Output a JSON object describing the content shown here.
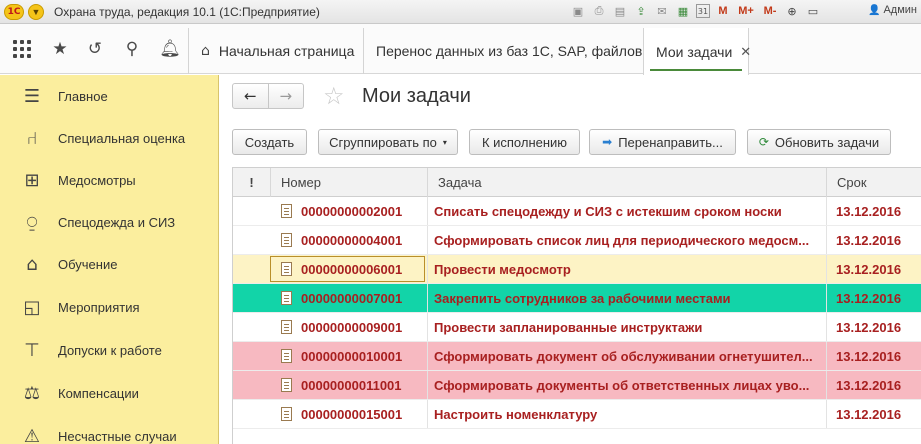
{
  "titlebar": {
    "logo": "1С",
    "title": "Охрана труда, редакция 10.1  (1С:Предприятие)",
    "icons": [
      "save-icon",
      "print-icon",
      "preview-icon",
      "attach-icon",
      "email-icon",
      "spreadsheet-icon",
      "calendar-icon"
    ],
    "calendar_label": "31",
    "m_labels": [
      "M",
      "M+",
      "M-"
    ],
    "user": "Админ"
  },
  "navbar": {
    "tabs": [
      {
        "label": "Начальная страница",
        "icon": "home-icon"
      },
      {
        "label": "Перенос данных из баз 1С, SAP, файлов",
        "close": "✕"
      },
      {
        "label": "Мои задачи",
        "close": "✕"
      }
    ]
  },
  "sidebar": {
    "items": [
      {
        "label": "Главное",
        "icon": "menu-lines-icon"
      },
      {
        "label": "Специальная оценка",
        "icon": "chair-icon"
      },
      {
        "label": "Медосмотры",
        "icon": "medkit-icon"
      },
      {
        "label": "Спецодежда и СИЗ",
        "icon": "jacket-icon"
      },
      {
        "label": "Обучение",
        "icon": "graduation-cap-icon"
      },
      {
        "label": "Мероприятия",
        "icon": "chart-board-icon"
      },
      {
        "label": "Допуски к работе",
        "icon": "crane-icon"
      },
      {
        "label": "Компенсации",
        "icon": "scales-icon"
      },
      {
        "label": "Несчастные случаи",
        "icon": "warning-icon"
      }
    ]
  },
  "main": {
    "title": "Мои задачи",
    "buttons": {
      "create": "Создать",
      "group": "Сгруппировать по",
      "execute": "К исполнению",
      "redirect": "Перенаправить...",
      "refresh": "Обновить задачи"
    },
    "columns": {
      "flag": "!",
      "number": "Номер",
      "task": "Задача",
      "due": "Срок"
    },
    "rows": [
      {
        "number": "00000000002001",
        "task": "Списать спецодежду и СИЗ с истекшим сроком носки",
        "due": "13.12.2016",
        "bg": "#ffffff"
      },
      {
        "number": "00000000004001",
        "task": "Сформировать список лиц для периодического медосм...",
        "due": "13.12.2016",
        "bg": "#ffffff"
      },
      {
        "number": "00000000006001",
        "task": "Провести медосмотр",
        "due": "13.12.2016",
        "bg": "#fdf3c5"
      },
      {
        "number": "00000000007001",
        "task": "Закрепить сотрудников за рабочими местами",
        "due": "13.12.2016",
        "bg": "#12d4a8"
      },
      {
        "number": "00000000009001",
        "task": "Провести запланированные инструктажи",
        "due": "13.12.2016",
        "bg": "#ffffff"
      },
      {
        "number": "00000000010001",
        "task": "Сформировать документ об обслуживании огнетушител...",
        "due": "13.12.2016",
        "bg": "#f7b9c1"
      },
      {
        "number": "00000000011001",
        "task": "Сформировать документы об ответственных лицах уво...",
        "due": "13.12.2016",
        "bg": "#f7b9c1"
      },
      {
        "number": "00000000015001",
        "task": "Настроить номенклатуру",
        "due": "13.12.2016",
        "bg": "#ffffff"
      }
    ]
  }
}
